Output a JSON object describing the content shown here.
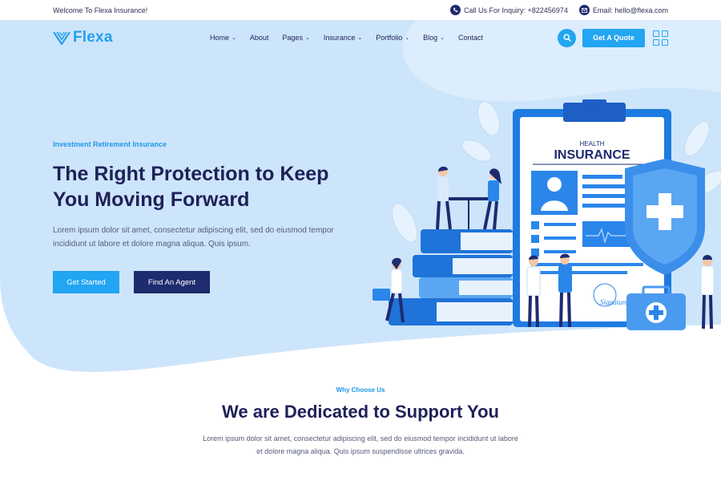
{
  "topbar": {
    "welcome": "Welcome To Flexa Insurance!",
    "phone": "Call Us For Inquiry: +822456974",
    "email": "Email: hello@flexa.com"
  },
  "brand": {
    "name": "Flexa",
    "color": "#23a0f0"
  },
  "nav": {
    "items": [
      {
        "label": "Home",
        "dropdown": true
      },
      {
        "label": "About",
        "dropdown": false
      },
      {
        "label": "Pages",
        "dropdown": true
      },
      {
        "label": "Insurance",
        "dropdown": true
      },
      {
        "label": "Portfolio",
        "dropdown": true
      },
      {
        "label": "Blog",
        "dropdown": true
      },
      {
        "label": "Contact",
        "dropdown": false
      }
    ],
    "quote_label": "Get A Quote"
  },
  "hero": {
    "eyebrow": "Investment Retirement Insurance",
    "headline_line1": "The Right Protection to Keep",
    "headline_line2": "You Moving Forward",
    "subtext": "Lorem ipsum dolor sit amet, consectetur adipiscing elit, sed do eiusmod tempor incididunt ut labore et dolore magna aliqua. Quis ipsum.",
    "primary_button": "Get Started",
    "secondary_button": "Find An Agent"
  },
  "illustration": {
    "card_small": "HEALTH",
    "card_title": "INSURANCE",
    "signature": "Signature"
  },
  "why": {
    "eyebrow": "Why Choose Us",
    "title": "We are Dedicated to Support You",
    "subtext": "Lorem ipsum dolor sit amet, consectetur adipiscing elit, sed do eiusmod tempor incididunt ut labore et dolore magna aliqua. Quis ipsum suspendisse ultrices gravida."
  },
  "colors": {
    "accent": "#22a5f2",
    "navy": "#1e2b6f",
    "hero_bg": "#cfe6fb"
  }
}
